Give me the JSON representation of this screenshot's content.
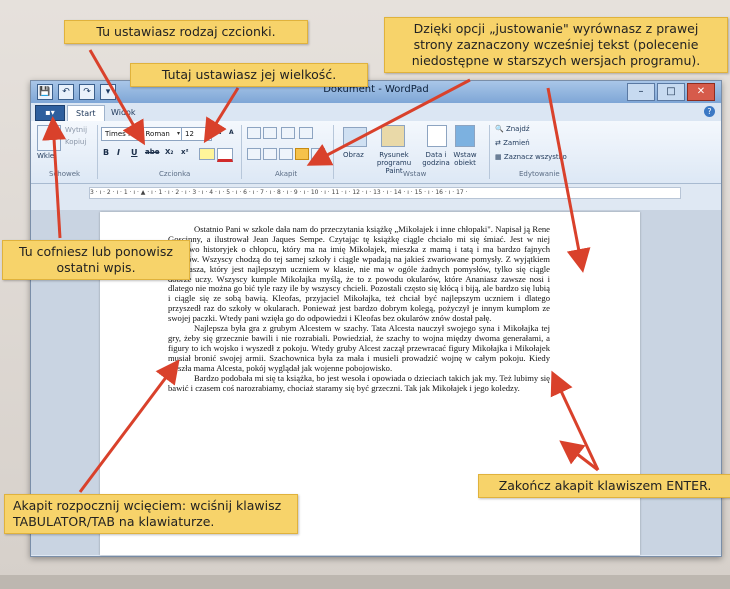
{
  "window": {
    "title": "Dokument - WordPad",
    "quick_access": [
      "💾",
      "↶",
      "↷",
      "▾"
    ],
    "controls": [
      "–",
      "□",
      "✕"
    ]
  },
  "tabs": {
    "menu": "▪▾",
    "items": [
      "Start",
      "Widok"
    ],
    "help": "?"
  },
  "ribbon": {
    "groups": [
      "Schowek",
      "Czcionka",
      "Akapit",
      "Wstaw",
      "Edytowanie"
    ],
    "clipboard": {
      "paste": "Wklej",
      "cut": "Wytnij",
      "copy": "Kopiuj"
    },
    "font": {
      "family": "Times New Roman",
      "size": "12",
      "grow": "A",
      "shrink": "A",
      "bold": "B",
      "italic": "I",
      "underline": "U",
      "strike": "abe",
      "sub": "X₂",
      "sup": "x²"
    },
    "insert": {
      "image": "Obraz",
      "paint": "Rysunek programu Paint",
      "date": "Data i godzina",
      "object": "Wstaw obiekt"
    },
    "editing": {
      "find": "Znajdź",
      "replace": "Zamień",
      "select_all": "Zaznacz wszystko"
    }
  },
  "ruler": "3 · ı · 2 · ı · 1 · ı · ▲ · ı · 1 · ı · 2 · ı · 3 · ı · 4 · ı · 5 · ı · 6 · ı · 7 · ı · 8 · ı · 9 · ı · 10 · ı · 11 · ı · 12 · ı · 13 · ı · 14 · ı · 15 · ı · 16 · ı · 17 ·",
  "document": {
    "paragraphs": [
      "Ostatnio Pani w szkole dała nam do przeczytania książkę „Mikołajek i inne chłopaki\". Napisał ją Rene Goscinny, a ilustrował Jean Jaques Sempe. Czytając tę książkę ciągle chciało mi się śmiać. Jest w niej mnóstwo historyjek o chłopcu, który ma na imię Mikołajek, mieszka z mamą i tatą i ma bardzo fajnych kolegów. Wszyscy chodzą do tej samej szkoły i ciągle wpadają na jakieś zwariowane pomysły. Z wyjątkiem Ananiasza, który jest najlepszym uczniem w klasie, nie ma w ogóle żadnych pomysłów, tylko się ciągle dobrze uczy. Wszyscy kumple Mikołajka myślą, że to z powodu okularów, które Ananiasz zawsze nosi i dlatego nie można go bić tyle razy ile by wszyscy chcieli. Pozostali często się kłócą i biją, ale bardzo się lubią i ciągle się ze sobą bawią. Kleofas, przyjaciel Mikołajka, też chciał być najlepszym uczniem i dlatego przyszedł raz do szkoły w okularach. Ponieważ jest bardzo dobrym kolegą, pożyczył je innym kumplom ze swojej paczki. Wtedy pani wzięła go do odpowiedzi i Kleofas bez okularów znów dostał pałę.",
      "Najlepsza była gra z grubym Alcestem w szachy. Tata Alcesta nauczył swojego syna i Mikołajka tej gry, żeby się grzecznie bawili i nie rozrabiali. Powiedział, że szachy to wojna między dwoma generałami, a figury to ich wojsko i wyszedł z pokoju. Wtedy gruby Alcest zaczął przewracać figury Mikołajka i Mikołajek musiał bronić swojej armii. Szachownica była za mała i musieli prowadzić wojnę w całym pokoju. Kiedy weszła mama Alcesta, pokój wyglądał jak wojenne pobojowisko.",
      "Bardzo podobała mi się ta książka, bo jest wesoła i opowiada o dzieciach takich jak my. Też lubimy się bawić i czasem coś narozrabiamy, chociaż staramy się być grzeczni. Tak jak Mikołajek i jego koledzy."
    ]
  },
  "callouts": {
    "font_type": "Tu ustawiasz rodzaj czcionki.",
    "font_size": "Tutaj ustawiasz jej wielkość.",
    "justify": "Dzięki opcji „justowanie\" wyrównasz z prawej strony zaznaczony wcześniej tekst (polecenie niedostępne w starszych wersjach programu).",
    "undo": "Tu cofniesz lub ponowisz ostatni wpis.",
    "indent": "Akapit rozpocznij wcięciem: wciśnij klawisz TABULATOR/TAB na klawiaturze.",
    "enter": "Zakończ akapit klawiszem ENTER."
  },
  "colors": {
    "callout": "#f7d36a",
    "arrow": "#d9412b"
  }
}
